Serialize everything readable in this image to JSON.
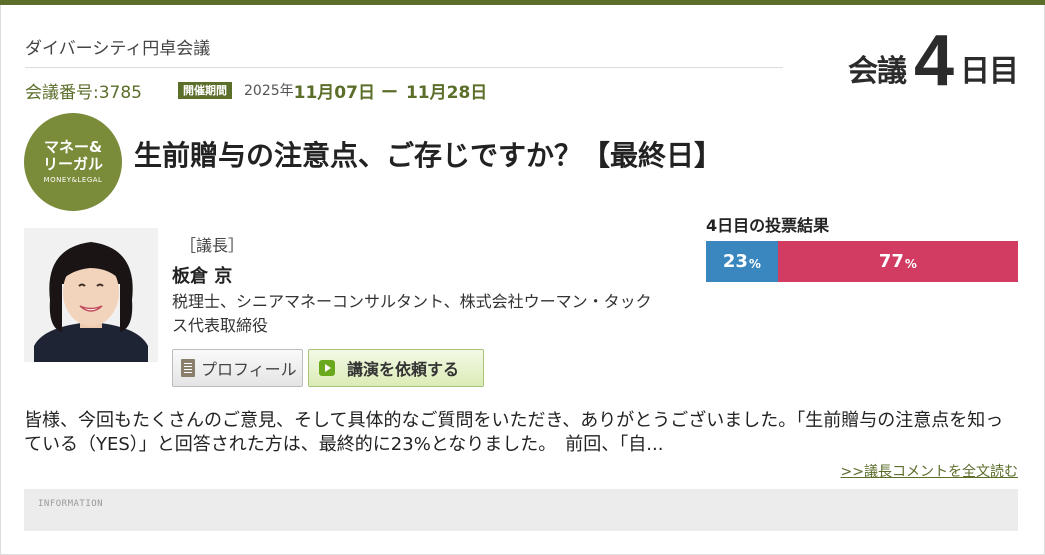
{
  "site": {
    "title": "ダイバーシティ円卓会議"
  },
  "meeting": {
    "number_label": "会議番号:3785",
    "period_badge": "開催期間",
    "period_year": "2025年",
    "period_start": "11月07日",
    "period_dash": "ー",
    "period_end": "11月28日"
  },
  "day_counter": {
    "prefix": "会議",
    "number": "4",
    "suffix": "日目"
  },
  "category": {
    "line1": "マネー&",
    "line2": "リーガル",
    "english": "MONEY&LEGAL",
    "color": "#7a8b3a"
  },
  "topic": {
    "title": "生前贈与の注意点、ご存じですか？【最終日】"
  },
  "chair": {
    "role": "［議長］",
    "name": "板倉 京",
    "description": "税理士、シニアマネーコンサルタント、株式会社ウーマン・タックス代表取締役"
  },
  "buttons": {
    "profile": "プロフィール",
    "request": "講演を依頼する"
  },
  "vote": {
    "title": "4日目の投票結果",
    "yes_percent": 23,
    "no_percent": 77,
    "unit": "%",
    "yes_color": "#3a87c0",
    "no_color": "#d23b62"
  },
  "comment": {
    "text": "皆様、今回もたくさんのご意見、そして具体的なご質問をいただき、ありがとうございました。「生前贈与の注意点を知っている（YES）」と回答された方は、最終的に23%となりました。　前回、「自...",
    "read_more": ">>議長コメントを全文読む"
  },
  "info": {
    "label": "INFORMATION"
  },
  "icons": {
    "profile": "document-icon",
    "request": "play-icon"
  }
}
